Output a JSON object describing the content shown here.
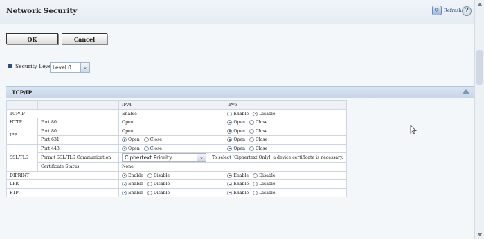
{
  "header": {
    "title": "Network Security",
    "refresh_label": "Refresh"
  },
  "buttons": {
    "ok": "OK",
    "cancel": "Cancel"
  },
  "security_level": {
    "label": "Security Level",
    "colon": ":",
    "value": "Level 0"
  },
  "section": {
    "title": "TCP/IP"
  },
  "table": {
    "col_ipv4": "IPv4",
    "col_ipv6": "IPv6",
    "rows": {
      "tcpip": {
        "label": "TCP/IP",
        "ipv4": "Enable",
        "ipv6_opt1": "Enable",
        "ipv6_opt2": "Disable"
      },
      "http": {
        "label": "HTTP",
        "port": "Port 80",
        "ipv4": "Open",
        "ipv6_opt1": "Open",
        "ipv6_opt2": "Close"
      },
      "ipp": {
        "label": "IPP",
        "port80": "Port 80",
        "port80_ipv4": "Open",
        "port631": "Port 631",
        "opt1": "Open",
        "opt2": "Close"
      },
      "ssltls": {
        "label": "SSL/TLS",
        "port443": "Port 443",
        "permit": "Permit SSL/TLS Communication",
        "cipher_value": "Ciphertext Priority",
        "cipher_note": "To select [Ciphertext Only], a device certificate is necessary.",
        "cert_status_label": "Certificate Status",
        "cert_status_value": "None",
        "opt1": "Open",
        "opt2": "Close"
      },
      "diprint": {
        "label": "DIPRINT",
        "opt1": "Enable",
        "opt2": "Disable"
      },
      "lpr": {
        "label": "LPR",
        "opt1": "Enable",
        "opt2": "Disable"
      },
      "ftp": {
        "label": "FTP",
        "opt1": "Enable",
        "opt2": "Disable"
      }
    }
  },
  "icons": {
    "refresh": "refresh-icon",
    "help": "help-icon",
    "dropdown": "chevron-down-icon",
    "collapse": "collapse-up-icon",
    "cursor": "mouse-pointer-icon"
  },
  "colors": {
    "header_bg": "#e5ecf3",
    "section_bg": "#c6d6e8",
    "bullet": "#2b4f88"
  }
}
